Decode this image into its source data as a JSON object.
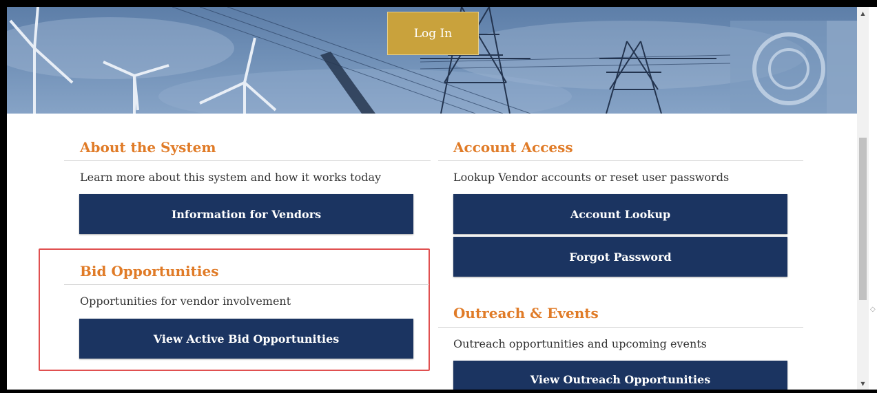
{
  "header": {
    "login_label": "Log In"
  },
  "about": {
    "title": "About the System",
    "description": "Learn more about this system and how it works today",
    "button_label": "Information for Vendors"
  },
  "account": {
    "title": "Account Access",
    "description": "Lookup Vendor accounts or reset user passwords",
    "lookup_label": "Account Lookup",
    "forgot_label": "Forgot Password"
  },
  "bids": {
    "title": "Bid Opportunities",
    "description": "Opportunities for vendor involvement",
    "button_label": "View Active Bid Opportunities"
  },
  "outreach": {
    "title": "Outreach & Events",
    "description": "Outreach opportunities and upcoming events",
    "button_label": "View Outreach Opportunities"
  },
  "colors": {
    "accent": "#e07b27",
    "button_bg": "#1b3461",
    "login_bg": "#c9a23c",
    "highlight": "#e05050"
  },
  "icons": [
    "scroll-up-arrow-icon",
    "scroll-down-arrow-icon",
    "collapse-handle-icon"
  ]
}
